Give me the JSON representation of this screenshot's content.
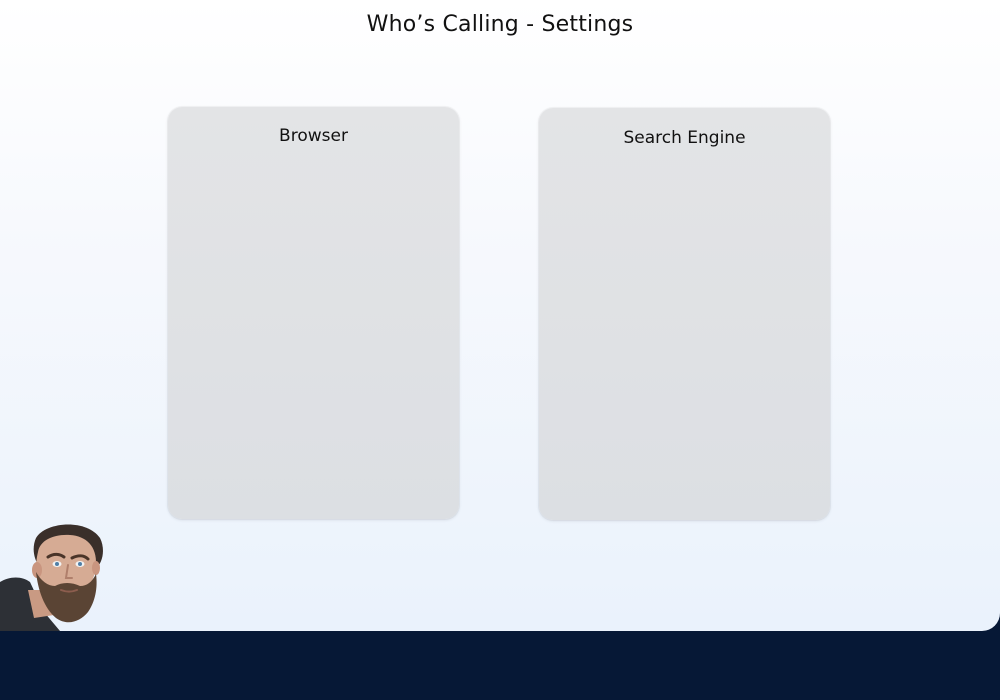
{
  "window": {
    "title": "Who’s Calling - Settings"
  },
  "panels": [
    {
      "title": "Browser"
    },
    {
      "title": "Search Engine"
    }
  ],
  "colors": {
    "bottom_bar": "#061836",
    "panel": "#dfe1e4"
  },
  "avatar": {
    "icon": "presenter-avatar"
  }
}
